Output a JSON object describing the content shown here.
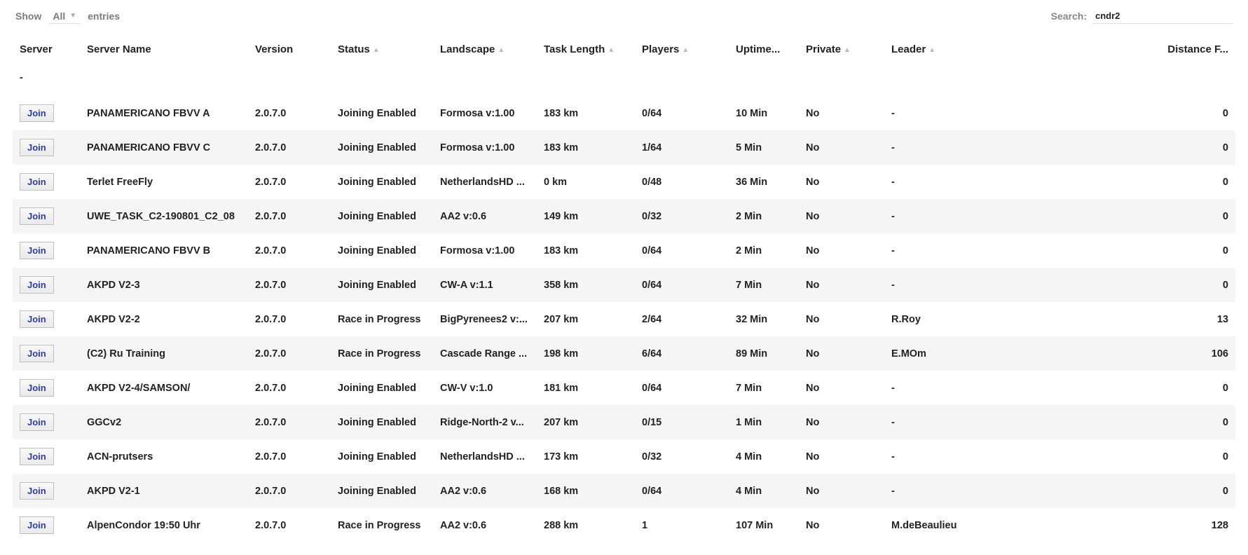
{
  "topbar": {
    "show_label": "Show",
    "show_value": "All",
    "entries_label": "entries",
    "search_label": "Search:",
    "search_value": "cndr2"
  },
  "columns": {
    "server": "Server",
    "name": "Server Name",
    "version": "Version",
    "status": "Status",
    "landscape": "Landscape",
    "task": "Task Length",
    "players": "Players",
    "uptime": "Uptime...",
    "private": "Private",
    "leader": "Leader",
    "distance": "Distance F..."
  },
  "subheader_server": "-",
  "join_label": "Join",
  "rows": [
    {
      "name": "PANAMERICANO FBVV A",
      "version": "2.0.7.0",
      "status": "Joining Enabled",
      "landscape": "Formosa v:1.00",
      "task": "183 km",
      "players": "0/64",
      "uptime": "10 Min",
      "private": "No",
      "leader": "-",
      "distance": "0"
    },
    {
      "name": "PANAMERICANO FBVV C",
      "version": "2.0.7.0",
      "status": "Joining Enabled",
      "landscape": "Formosa v:1.00",
      "task": "183 km",
      "players": "1/64",
      "uptime": "5 Min",
      "private": "No",
      "leader": "-",
      "distance": "0"
    },
    {
      "name": "Terlet FreeFly",
      "version": "2.0.7.0",
      "status": "Joining Enabled",
      "landscape": "NetherlandsHD ...",
      "task": "0 km",
      "players": "0/48",
      "uptime": "36 Min",
      "private": "No",
      "leader": "-",
      "distance": "0"
    },
    {
      "name": "UWE_TASK_C2-190801_C2_08",
      "version": "2.0.7.0",
      "status": "Joining Enabled",
      "landscape": "AA2 v:0.6",
      "task": "149 km",
      "players": "0/32",
      "uptime": "2 Min",
      "private": "No",
      "leader": "-",
      "distance": "0"
    },
    {
      "name": "PANAMERICANO FBVV B",
      "version": "2.0.7.0",
      "status": "Joining Enabled",
      "landscape": "Formosa v:1.00",
      "task": "183 km",
      "players": "0/64",
      "uptime": "2 Min",
      "private": "No",
      "leader": "-",
      "distance": "0"
    },
    {
      "name": "AKPD V2-3",
      "version": "2.0.7.0",
      "status": "Joining Enabled",
      "landscape": "CW-A v:1.1",
      "task": "358 km",
      "players": "0/64",
      "uptime": "7 Min",
      "private": "No",
      "leader": "-",
      "distance": "0"
    },
    {
      "name": "AKPD V2-2",
      "version": "2.0.7.0",
      "status": "Race in Progress",
      "landscape": "BigPyrenees2 v:...",
      "task": "207 km",
      "players": "2/64",
      "uptime": "32 Min",
      "private": "No",
      "leader": "R.Roy",
      "distance": "13"
    },
    {
      "name": "(C2) Ru Training",
      "version": "2.0.7.0",
      "status": "Race in Progress",
      "landscape": "Cascade Range ...",
      "task": "198 km",
      "players": "6/64",
      "uptime": "89 Min",
      "private": "No",
      "leader": "E.MOm",
      "distance": "106"
    },
    {
      "name": "AKPD V2-4/SAMSON/",
      "version": "2.0.7.0",
      "status": "Joining Enabled",
      "landscape": "CW-V v:1.0",
      "task": "181 km",
      "players": "0/64",
      "uptime": "7 Min",
      "private": "No",
      "leader": "-",
      "distance": "0"
    },
    {
      "name": "GGCv2",
      "version": "2.0.7.0",
      "status": "Joining Enabled",
      "landscape": "Ridge-North-2 v...",
      "task": "207 km",
      "players": "0/15",
      "uptime": "1 Min",
      "private": "No",
      "leader": "-",
      "distance": "0"
    },
    {
      "name": "ACN-prutsers",
      "version": "2.0.7.0",
      "status": "Joining Enabled",
      "landscape": "NetherlandsHD ...",
      "task": "173 km",
      "players": "0/32",
      "uptime": "4 Min",
      "private": "No",
      "leader": "-",
      "distance": "0"
    },
    {
      "name": "AKPD V2-1",
      "version": "2.0.7.0",
      "status": "Joining Enabled",
      "landscape": "AA2 v:0.6",
      "task": "168 km",
      "players": "0/64",
      "uptime": "4 Min",
      "private": "No",
      "leader": "-",
      "distance": "0"
    },
    {
      "name": "AlpenCondor 19:50 Uhr",
      "version": "2.0.7.0",
      "status": "Race in Progress",
      "landscape": "AA2 v:0.6",
      "task": "288 km",
      "players": "1",
      "uptime": "107 Min",
      "private": "No",
      "leader": "M.deBeaulieu",
      "distance": "128"
    }
  ]
}
